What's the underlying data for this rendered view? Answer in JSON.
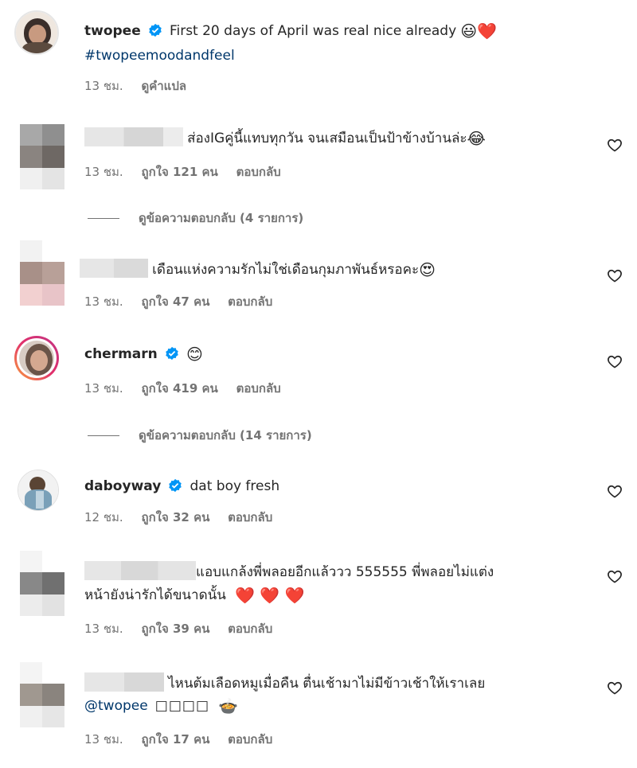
{
  "post": {
    "username": "twopee",
    "caption": "First 20 days of April was real nice already",
    "caption_emoji": "😃❤️",
    "hashtag": "#twopeemoodandfeel",
    "time": "13 ชม.",
    "translate": "ดูคำแปล"
  },
  "comments": [
    {
      "text": "ส่องIGคู่นี้แทบทุกวัน จนเสมือนเป็นป้าข้างบ้านล่ะ",
      "emoji": "😂",
      "time": "13 ชม.",
      "likes": "ถูกใจ 121 คน",
      "reply": "ตอบกลับ",
      "view_replies": "ดูข้อความตอบกลับ (4 รายการ)"
    },
    {
      "text": "เดือนแห่งความรักไม่ใช่เดือนกุมภาพันธ์หรอคะ",
      "emoji": "😍",
      "time": "13 ชม.",
      "likes": "ถูกใจ 47 คน",
      "reply": "ตอบกลับ"
    },
    {
      "username": "chermarn",
      "emoji": "😊",
      "time": "13 ชม.",
      "likes": "ถูกใจ 419 คน",
      "reply": "ตอบกลับ",
      "view_replies": "ดูข้อความตอบกลับ (14 รายการ)"
    },
    {
      "username": "daboyway",
      "text": "dat boy fresh",
      "time": "12 ชม.",
      "likes": "ถูกใจ 32 คน",
      "reply": "ตอบกลับ"
    },
    {
      "text_line1": "แอบแกล้งพี่พลอยอีกแล้ววว 555555 พี่พลอยไม่แต่ง",
      "text_line2": "หน้ายังน่ารักได้ขนาดนั้น",
      "emoji": "❤️ ❤️ ❤️",
      "time": "13 ชม.",
      "likes": "ถูกใจ 39 คน",
      "reply": "ตอบกลับ"
    },
    {
      "text_line1": "ไหนต้มเลือดหมูเมื่อคืน ตื่นเช้ามาไม่มีข้าวเช้าให้เราเลย",
      "mention": "@twopee",
      "boxes": "□□□□",
      "emoji": "🍲",
      "time": "13 ชม.",
      "likes": "ถูกใจ 17 คน",
      "reply": "ตอบกลับ"
    }
  ],
  "colors": {
    "text": "#262626",
    "secondary": "#737373",
    "link": "#00376b",
    "verified": "#0095f6"
  }
}
